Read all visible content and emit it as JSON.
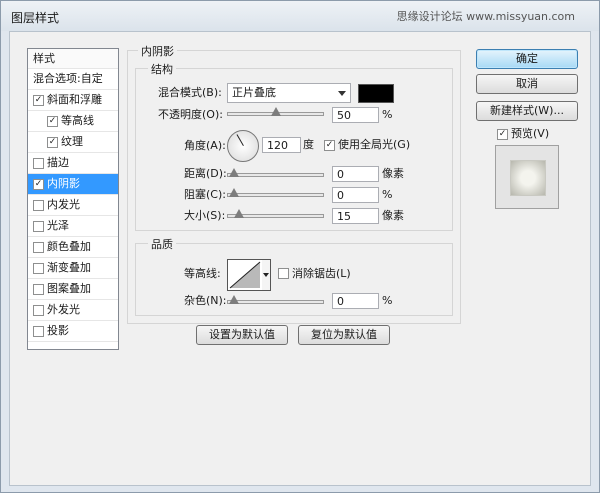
{
  "window": {
    "title": "图层样式",
    "watermark": "思缘设计论坛 www.missyuan.com"
  },
  "styles_panel": {
    "header": "样式",
    "items": [
      {
        "label": "混合选项:自定",
        "checkbox": false,
        "checked": false,
        "indent": 0,
        "selected": false
      },
      {
        "label": "斜面和浮雕",
        "checkbox": true,
        "checked": true,
        "indent": 0,
        "selected": false
      },
      {
        "label": "等高线",
        "checkbox": true,
        "checked": true,
        "indent": 1,
        "selected": false
      },
      {
        "label": "纹理",
        "checkbox": true,
        "checked": true,
        "indent": 1,
        "selected": false
      },
      {
        "label": "描边",
        "checkbox": true,
        "checked": false,
        "indent": 0,
        "selected": false
      },
      {
        "label": "内阴影",
        "checkbox": true,
        "checked": true,
        "indent": 0,
        "selected": true
      },
      {
        "label": "内发光",
        "checkbox": true,
        "checked": false,
        "indent": 0,
        "selected": false
      },
      {
        "label": "光泽",
        "checkbox": true,
        "checked": false,
        "indent": 0,
        "selected": false
      },
      {
        "label": "颜色叠加",
        "checkbox": true,
        "checked": false,
        "indent": 0,
        "selected": false
      },
      {
        "label": "渐变叠加",
        "checkbox": true,
        "checked": false,
        "indent": 0,
        "selected": false
      },
      {
        "label": "图案叠加",
        "checkbox": true,
        "checked": false,
        "indent": 0,
        "selected": false
      },
      {
        "label": "外发光",
        "checkbox": true,
        "checked": false,
        "indent": 0,
        "selected": false
      },
      {
        "label": "投影",
        "checkbox": true,
        "checked": false,
        "indent": 0,
        "selected": false
      }
    ]
  },
  "inner_shadow": {
    "section_title": "内阴影",
    "structure": {
      "title": "结构",
      "blend_mode_label": "混合模式(B):",
      "blend_mode_value": "正片叠底",
      "shadow_color": "#000000",
      "opacity_label": "不透明度(O):",
      "opacity_value": "50",
      "opacity_fraction": 0.5,
      "opacity_unit": "%",
      "angle_label": "角度(A):",
      "angle_value": "120",
      "angle_deg": 120,
      "angle_unit": "度",
      "global_light_label": "使用全局光(G)",
      "global_light_checked": true,
      "distance_label": "距离(D):",
      "distance_value": "0",
      "distance_fraction": 0,
      "distance_unit": "像素",
      "choke_label": "阻塞(C):",
      "choke_value": "0",
      "choke_fraction": 0,
      "choke_unit": "%",
      "size_label": "大小(S):",
      "size_value": "15",
      "size_fraction": 0.06,
      "size_unit": "像素"
    },
    "quality": {
      "title": "品质",
      "contour_label": "等高线:",
      "antialias_label": "消除锯齿(L)",
      "antialias_checked": false,
      "noise_label": "杂色(N):",
      "noise_value": "0",
      "noise_fraction": 0,
      "noise_unit": "%"
    },
    "make_default_label": "设置为默认值",
    "reset_default_label": "复位为默认值"
  },
  "actions": {
    "ok_label": "确定",
    "cancel_label": "取消",
    "new_style_label": "新建样式(W)...",
    "preview_label": "预览(V)",
    "preview_checked": true
  },
  "colors": {
    "selection": "#3399ff",
    "default_button": "#a7d9f5"
  }
}
